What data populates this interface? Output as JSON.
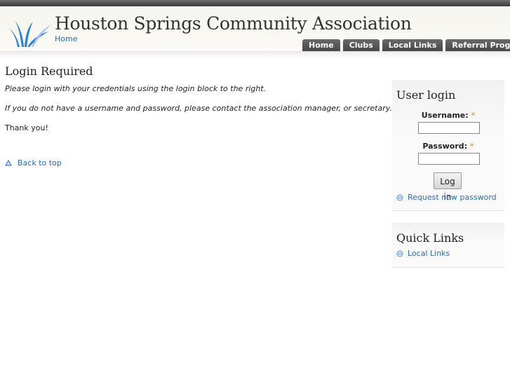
{
  "header": {
    "site_name": "Houston Springs Community Association",
    "home_link": "Home",
    "tabs": [
      "Home",
      "Clubs",
      "Local Links",
      "Referral Program"
    ]
  },
  "main": {
    "title": "Login Required",
    "message_1": "Please login with your credentials using the login block to the right.",
    "message_2": "If you do not have a username and password, please contact the association manager, or secretary.",
    "thanks": "Thank you!",
    "back_to_top": "Back to top"
  },
  "login": {
    "title": "User login",
    "username_label": "Username:",
    "password_label": "Password:",
    "required_mark": "*",
    "username_value": "",
    "password_value": "",
    "button": "Log in",
    "request_password": "Request new password"
  },
  "quick_links": {
    "title": "Quick Links",
    "items": [
      "Local Links"
    ]
  },
  "colors": {
    "link": "#2a6ab8",
    "tab_bg": "#555555",
    "required": "#e8a24b",
    "logo": "#2f7fd6"
  },
  "icons": {
    "logo": "grass-logo-icon",
    "back_to_top": "up-triangle-icon",
    "bullet": "circle-bullet-icon"
  }
}
